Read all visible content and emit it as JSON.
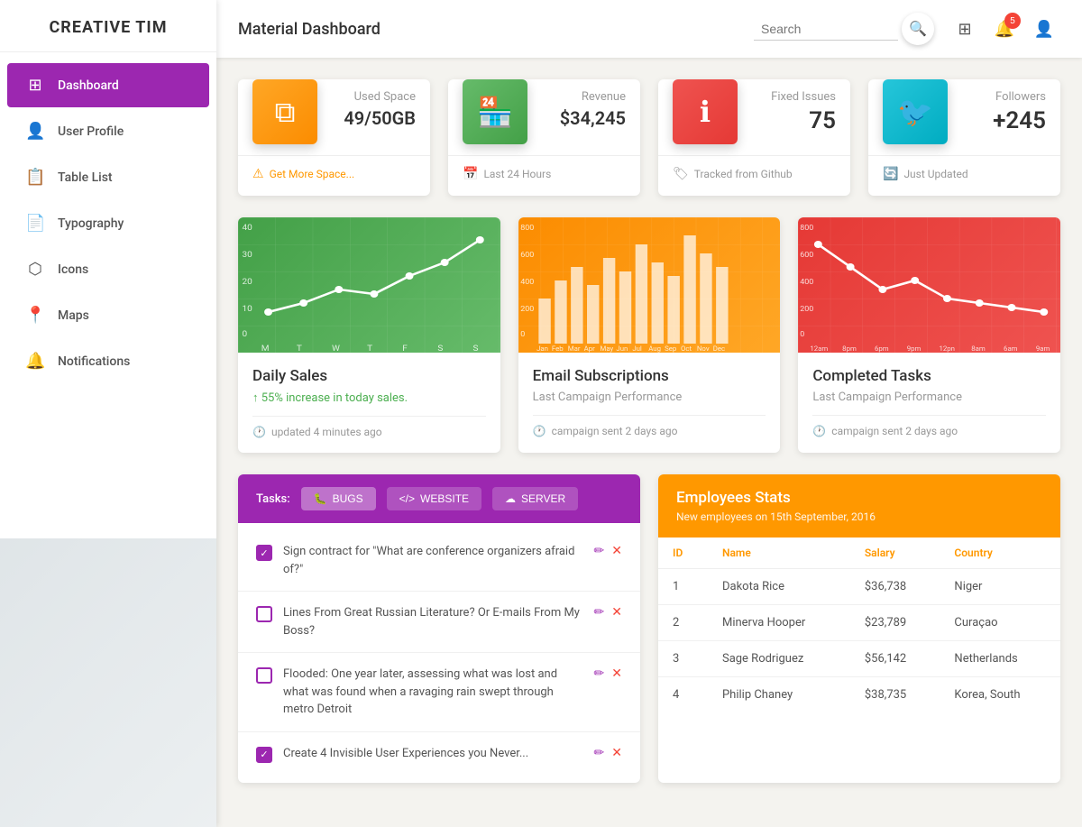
{
  "sidebar": {
    "logo": "CREATIVE TIM",
    "items": [
      {
        "id": "dashboard",
        "label": "Dashboard",
        "icon": "⊞",
        "active": true
      },
      {
        "id": "user-profile",
        "label": "User Profile",
        "icon": "👤",
        "active": false
      },
      {
        "id": "table-list",
        "label": "Table List",
        "icon": "📋",
        "active": false
      },
      {
        "id": "typography",
        "label": "Typography",
        "icon": "📄",
        "active": false
      },
      {
        "id": "icons",
        "label": "Icons",
        "icon": "⬡",
        "active": false
      },
      {
        "id": "maps",
        "label": "Maps",
        "icon": "📍",
        "active": false
      },
      {
        "id": "notifications",
        "label": "Notifications",
        "icon": "🔔",
        "active": false
      }
    ]
  },
  "header": {
    "title": "Material Dashboard",
    "search_placeholder": "Search",
    "notification_count": "5"
  },
  "stat_cards": [
    {
      "id": "used-space",
      "icon": "⧉",
      "icon_color": "#ff9800",
      "label": "Used Space",
      "value": "49/50GB",
      "footer": "Get More Space...",
      "footer_icon": "⚠",
      "footer_color": "#ff9800"
    },
    {
      "id": "revenue",
      "icon": "🏪",
      "icon_color": "#4caf50",
      "label": "Revenue",
      "value": "$34,245",
      "footer": "Last 24 Hours",
      "footer_icon": "📅"
    },
    {
      "id": "fixed-issues",
      "icon": "ℹ",
      "icon_color": "#f44336",
      "label": "Fixed Issues",
      "value": "75",
      "footer": "Tracked from Github",
      "footer_icon": "🏷"
    },
    {
      "id": "followers",
      "icon": "🐦",
      "icon_color": "#00bcd4",
      "label": "Followers",
      "value": "+245",
      "footer": "Just Updated",
      "footer_icon": "🔄"
    }
  ],
  "chart_cards": [
    {
      "id": "daily-sales",
      "title": "Daily Sales",
      "subtitle": "↑ 55% increase in today sales.",
      "subtitle_color": "#4caf50",
      "footer": "updated 4 minutes ago",
      "color": "green",
      "x_labels": [
        "M",
        "T",
        "W",
        "T",
        "F",
        "S",
        "S"
      ],
      "y_labels": [
        "40",
        "30",
        "20",
        "10",
        "0"
      ],
      "type": "line"
    },
    {
      "id": "email-subscriptions",
      "title": "Email Subscriptions",
      "subtitle": "Last Campaign Performance",
      "subtitle_color": "#999",
      "footer": "campaign sent 2 days ago",
      "color": "orange",
      "x_labels": [
        "Jan",
        "Feb",
        "Mar",
        "Apr",
        "May",
        "Jun",
        "Jul",
        "Aug",
        "Sep",
        "Oct",
        "Nov",
        "Dec"
      ],
      "y_labels": [
        "800",
        "600",
        "400",
        "200",
        "0"
      ],
      "type": "bar"
    },
    {
      "id": "completed-tasks",
      "title": "Completed Tasks",
      "subtitle": "Last Campaign Performance",
      "subtitle_color": "#999",
      "footer": "campaign sent 2 days ago",
      "color": "red",
      "x_labels": [
        "12am",
        "8pm",
        "6pm",
        "9pm",
        "12pn",
        "8am",
        "6am",
        "9am"
      ],
      "y_labels": [
        "800",
        "600",
        "400",
        "200",
        "0"
      ],
      "type": "line"
    }
  ],
  "tasks": {
    "header_label": "Tasks:",
    "tabs": [
      {
        "id": "bugs",
        "label": "BUGS",
        "icon": "🐛",
        "active": true
      },
      {
        "id": "website",
        "label": "WEBSITE",
        "icon": "</>",
        "active": false
      },
      {
        "id": "server",
        "label": "SERVER",
        "icon": "☁",
        "active": false
      }
    ],
    "items": [
      {
        "id": 1,
        "text": "Sign contract for \"What are conference organizers afraid of?\"",
        "checked": true
      },
      {
        "id": 2,
        "text": "Lines From Great Russian Literature? Or E-mails From My Boss?",
        "checked": false
      },
      {
        "id": 3,
        "text": "Flooded: One year later, assessing what was lost and what was found when a ravaging rain swept through metro Detroit",
        "checked": false
      },
      {
        "id": 4,
        "text": "Create 4 Invisible User Experiences you Never...",
        "checked": true
      }
    ]
  },
  "employees": {
    "title": "Employees Stats",
    "subtitle": "New employees on 15th September, 2016",
    "columns": [
      "ID",
      "Name",
      "Salary",
      "Country"
    ],
    "rows": [
      {
        "id": "1",
        "name": "Dakota Rice",
        "salary": "$36,738",
        "country": "Niger"
      },
      {
        "id": "2",
        "name": "Minerva Hooper",
        "salary": "$23,789",
        "country": "Curaçao"
      },
      {
        "id": "3",
        "name": "Sage Rodriguez",
        "salary": "$56,142",
        "country": "Netherlands"
      },
      {
        "id": "4",
        "name": "Philip Chaney",
        "salary": "$38,735",
        "country": "Korea, South"
      }
    ]
  }
}
